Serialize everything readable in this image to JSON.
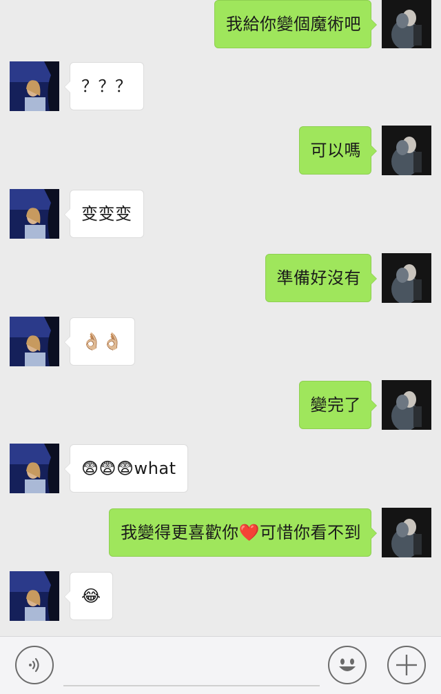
{
  "app": {
    "accent_color": "#9fe65c",
    "background": "#ebebeb"
  },
  "messages": [
    {
      "side": "out",
      "text": "我給你變個魔術吧",
      "avatar": "self-avatar"
    },
    {
      "side": "in",
      "text": "？？？",
      "avatar": "friend-avatar"
    },
    {
      "side": "out",
      "text": "可以嗎",
      "avatar": "self-avatar"
    },
    {
      "side": "in",
      "text": "变变变",
      "avatar": "friend-avatar"
    },
    {
      "side": "out",
      "text": "準備好沒有",
      "avatar": "self-avatar"
    },
    {
      "side": "in",
      "text": "👌🏼👌🏼",
      "avatar": "friend-avatar"
    },
    {
      "side": "out",
      "text": "變完了",
      "avatar": "self-avatar"
    },
    {
      "side": "in",
      "text": "😨😨😨what",
      "avatar": "friend-avatar"
    },
    {
      "side": "out",
      "text": "我變得更喜歡你❤️可惜你看不到",
      "avatar": "self-avatar"
    },
    {
      "side": "in",
      "text": "😂",
      "avatar": "friend-avatar"
    }
  ],
  "input_bar": {
    "voice_icon": "voice-icon",
    "message_value": "",
    "emoji_icon": "emoji-icon",
    "more_icon": "plus-icon"
  }
}
